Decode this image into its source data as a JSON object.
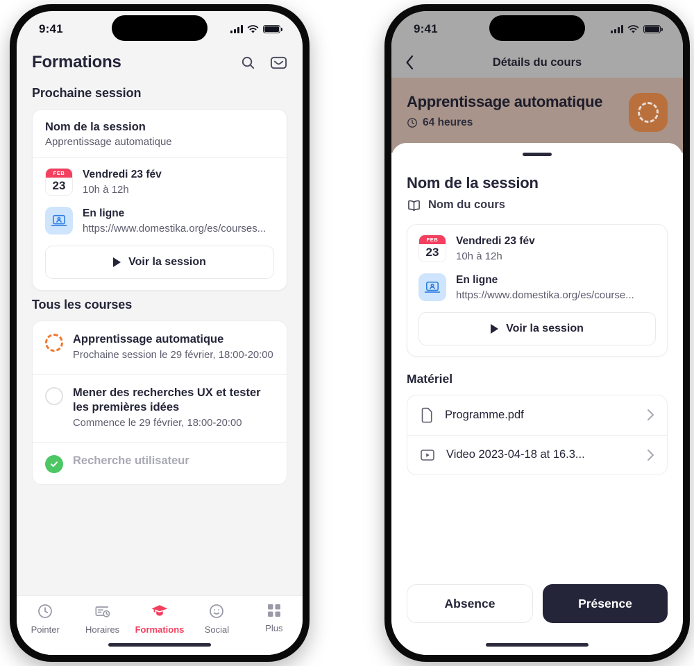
{
  "status_bar": {
    "time": "9:41",
    "signal_icon": "cellular-bars-icon",
    "wifi_icon": "wifi-icon",
    "battery_icon": "battery-icon"
  },
  "left_phone": {
    "header": {
      "title": "Formations",
      "search_icon": "search-icon",
      "mail_icon": "mail-icon"
    },
    "upcoming": {
      "section_title": "Prochaine session",
      "card": {
        "session_label": "Nom de la session",
        "course_name": "Apprentissage automatique",
        "date_icon": "calendar-icon",
        "date_month": "FEB",
        "date_day": "23",
        "date_text": "Vendredi 23 fév",
        "time_text": "10h à 12h",
        "location_icon": "laptop-webinar-icon",
        "location_text": "En ligne",
        "url_text": "https://www.domestika.org/es/courses...",
        "cta_label": "Voir la session",
        "cta_icon": "play-icon"
      }
    },
    "all_courses": {
      "section_title": "Tous les courses",
      "items": [
        {
          "status_icon": "progress-dashed-circle-icon",
          "status": "in-progress",
          "title": "Apprentissage automatique",
          "subtitle": "Prochaine session le 29 février, 18:00-20:00"
        },
        {
          "status_icon": "empty-circle-icon",
          "status": "not-started",
          "title": "Mener des recherches UX et tester les premières idées",
          "subtitle": "Commence le 29 février, 18:00-20:00"
        },
        {
          "status_icon": "check-circle-icon",
          "status": "completed",
          "title": "Recherche utilisateur",
          "subtitle": ""
        }
      ]
    },
    "tab_bar": {
      "items": [
        {
          "label": "Pointer",
          "icon": "clock-icon",
          "active": false
        },
        {
          "label": "Horaires",
          "icon": "schedule-icon",
          "active": false
        },
        {
          "label": "Formations",
          "icon": "graduation-cap-icon",
          "active": true
        },
        {
          "label": "Social",
          "icon": "smiley-icon",
          "active": false
        },
        {
          "label": "Plus",
          "icon": "grid-dots-icon",
          "active": false
        }
      ]
    }
  },
  "right_phone": {
    "nav": {
      "back_icon": "chevron-left-icon",
      "title": "Détails du cours"
    },
    "hero": {
      "title": "Apprentissage automatique",
      "hours_icon": "clock-icon",
      "hours_text": "64 heures",
      "badge_icon": "progress-dashed-circle-icon"
    },
    "sheet": {
      "grabber": "sheet-grabber",
      "session_label": "Nom de la session",
      "course_icon": "book-icon",
      "course_name": "Nom du cours",
      "card": {
        "date_icon": "calendar-icon",
        "date_month": "FEB",
        "date_day": "23",
        "date_text": "Vendredi 23 fév",
        "time_text": "10h à 12h",
        "location_icon": "laptop-webinar-icon",
        "location_text": "En ligne",
        "url_text": "https://www.domestika.org/es/course...",
        "cta_label": "Voir la session",
        "cta_icon": "play-icon"
      },
      "materials": {
        "section_title": "Matériel",
        "items": [
          {
            "icon": "document-icon",
            "label": "Programme.pdf",
            "chevron": "chevron-right-icon"
          },
          {
            "icon": "video-icon",
            "label": "Video 2023-04-18 at 16.3...",
            "chevron": "chevron-right-icon"
          }
        ]
      },
      "actions": {
        "secondary_label": "Absence",
        "primary_label": "Présence"
      }
    }
  },
  "colors": {
    "accent_red": "#f43f5e",
    "accent_orange": "#f2762c",
    "badge_orange": "#b9703c",
    "hero_band": "#a8948a",
    "nav_grey": "#a8a8a8",
    "ink": "#252539",
    "muted": "#5d5d6e",
    "success_green": "#4cc764"
  }
}
